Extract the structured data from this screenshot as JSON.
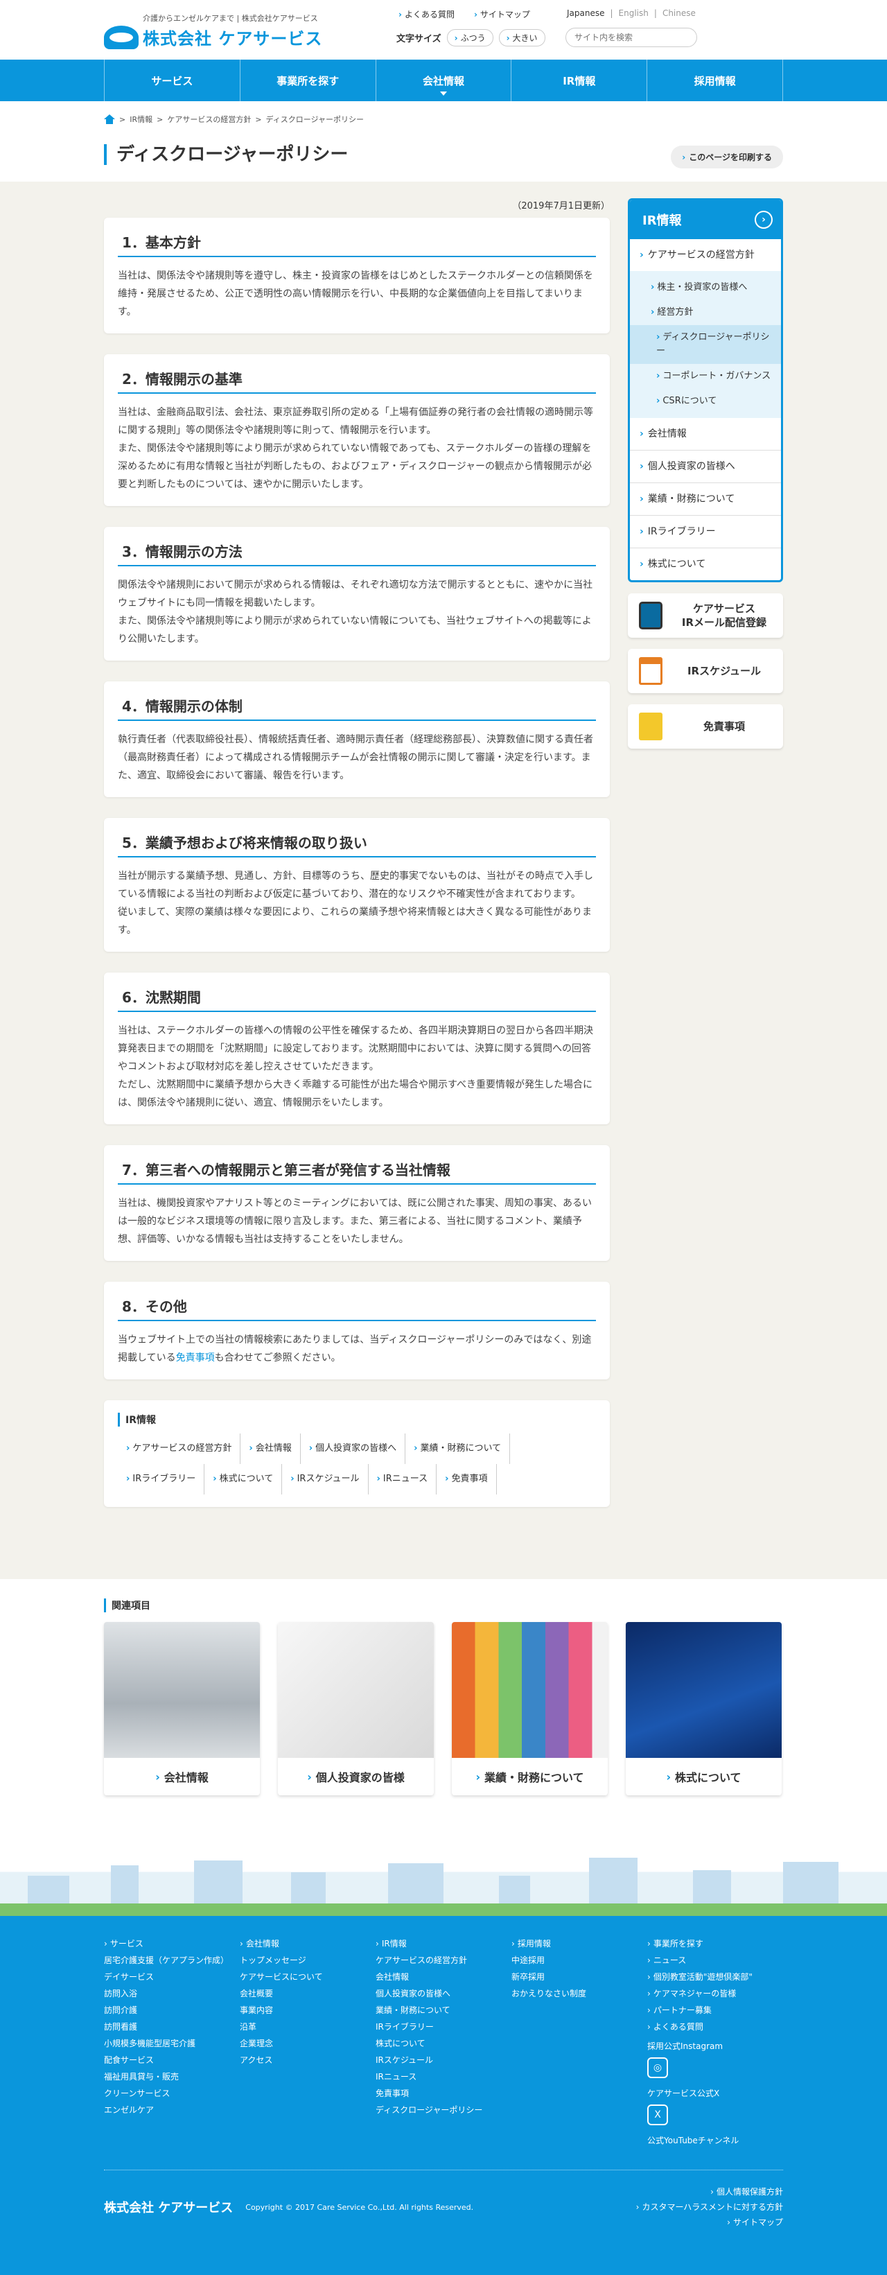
{
  "header": {
    "tagline": "介護からエンゼルケアまで | 株式会社ケアサービス",
    "logo_text": "株式会社 ケアサービス",
    "links": [
      "よくある質問",
      "サイトマップ"
    ],
    "fontsize_label": "文字サイズ",
    "fontsize_normal": "ふつう",
    "fontsize_large": "大きい",
    "langs": [
      "Japanese",
      "English",
      "Chinese"
    ],
    "search_placeholder": "サイト内を検索"
  },
  "nav": [
    "サービス",
    "事業所を探す",
    "会社情報",
    "IR情報",
    "採用情報"
  ],
  "breadcrumb": [
    "IR情報",
    "ケアサービスの経営方針",
    "ディスクロージャーポリシー"
  ],
  "page_title": "ディスクロージャーポリシー",
  "print_label": "このページを印刷する",
  "updated": "（2019年7月1日更新）",
  "sections": [
    {
      "title": "1．基本方針",
      "body": "当社は、関係法令や諸規則等を遵守し、株主・投資家の皆様をはじめとしたステークホルダーとの信頼関係を維持・発展させるため、公正で透明性の高い情報開示を行い、中長期的な企業価値向上を目指してまいります。"
    },
    {
      "title": "2．情報開示の基準",
      "body": "当社は、金融商品取引法、会社法、東京証券取引所の定める「上場有価証券の発行者の会社情報の適時開示等に関する規則」等の関係法令や諸規則等に則って、情報開示を行います。\nまた、関係法令や諸規則等により開示が求められていない情報であっても、ステークホルダーの皆様の理解を深めるために有用な情報と当社が判断したもの、およびフェア・ディスクロージャーの観点から情報開示が必要と判断したものについては、速やかに開示いたします。"
    },
    {
      "title": "3．情報開示の方法",
      "body": "関係法令や諸規則において開示が求められる情報は、それぞれ適切な方法で開示するとともに、速やかに当社ウェブサイトにも同一情報を掲載いたします。\nまた、関係法令や諸規則等により開示が求められていない情報についても、当社ウェブサイトへの掲載等により公開いたします。"
    },
    {
      "title": "4．情報開示の体制",
      "body": "執行責任者（代表取締役社長）、情報統括責任者、適時開示責任者（経理総務部長）、決算数値に関する責任者（最高財務責任者）によって構成される情報開示チームが会社情報の開示に関して審議・決定を行います。また、適宜、取締役会において審議、報告を行います。"
    },
    {
      "title": "5．業績予想および将来情報の取り扱い",
      "body": "当社が開示する業績予想、見通し、方針、目標等のうち、歴史的事実でないものは、当社がその時点で入手している情報による当社の判断および仮定に基づいており、潜在的なリスクや不確実性が含まれております。\n従いまして、実際の業績は様々な要因により、これらの業績予想や将来情報とは大きく異なる可能性があります。"
    },
    {
      "title": "6．沈黙期間",
      "body": "当社は、ステークホルダーの皆様への情報の公平性を確保するため、各四半期決算期日の翌日から各四半期決算発表日までの期間を「沈黙期間」に設定しております。沈黙期間中においては、決算に関する質問への回答やコメントおよび取材対応を差し控えさせていただきます。\nただし、沈黙期間中に業績予想から大きく乖離する可能性が出た場合や開示すべき重要情報が発生した場合には、関係法令や諸規則に従い、適宜、情報開示をいたします。"
    },
    {
      "title": "7．第三者への情報開示と第三者が発信する当社情報",
      "body": "当社は、機関投資家やアナリスト等とのミーティングにおいては、既に公開された事実、周知の事実、あるいは一般的なビジネス環境等の情報に限り言及します。また、第三者による、当社に関するコメント、業績予想、評価等、いかなる情報も当社は支持することをいたしません。"
    }
  ],
  "section8": {
    "title": "8．その他",
    "before": "当ウェブサイト上での当社の情報検索にあたりましては、当ディスクロージャーポリシーのみではなく、別途掲載している",
    "link": "免責事項",
    "after": "も合わせてご参照ください。"
  },
  "ir_links": {
    "title": "IR情報",
    "items": [
      "ケアサービスの経営方針",
      "会社情報",
      "個人投資家の皆様へ",
      "業績・財務について",
      "IRライブラリー",
      "株式について",
      "IRスケジュール",
      "IRニュース",
      "免責事項"
    ]
  },
  "side": {
    "title": "IR情報",
    "top": "ケアサービスの経営方針",
    "sub": [
      "株主・投資家の皆様へ",
      "経営方針",
      "ディスクロージャーポリシー",
      "コーポレート・ガバナンス",
      "CSRについて"
    ],
    "items": [
      "会社情報",
      "個人投資家の皆様へ",
      "業績・財務について",
      "IRライブラリー",
      "株式について"
    ],
    "banners": [
      "ケアサービス\nIRメール配信登録",
      "IRスケジュール",
      "免責事項"
    ]
  },
  "related": {
    "title": "関連項目",
    "cards": [
      "会社情報",
      "個人投資家の皆様",
      "業績・財務について",
      "株式について"
    ]
  },
  "footer": {
    "col1": [
      "サービス",
      "居宅介護支援（ケアプラン作成）",
      "デイサービス",
      "訪問入浴",
      "訪問介護",
      "訪問看護",
      "小規模多機能型居宅介護",
      "配食サービス",
      "福祉用具貸与・販売",
      "クリーンサービス",
      "エンゼルケア"
    ],
    "col2": [
      "会社情報",
      "トップメッセージ",
      "ケアサービスについて",
      "会社概要",
      "事業内容",
      "沿革",
      "企業理念",
      "アクセス"
    ],
    "col3": [
      "IR情報",
      "ケアサービスの経営方針",
      "会社情報",
      "個人投資家の皆様へ",
      "業績・財務について",
      "IRライブラリー",
      "株式について",
      "IRスケジュール",
      "IRニュース",
      "免責事項",
      "ディスクロージャーポリシー"
    ],
    "col4": [
      "採用情報",
      "中途採用",
      "新卒採用",
      "おかえりなさい制度"
    ],
    "col5": [
      "事業所を探す",
      "ニュース",
      "個別教室活動\"遊想倶楽部\"",
      "ケアマネジャーの皆様",
      "パートナー募集",
      "よくある質問"
    ],
    "instagram": "採用公式Instagram",
    "x": "ケアサービス公式X",
    "youtube": "公式YouTubeチャンネル",
    "logo": "株式会社 ケアサービス",
    "copyright": "Copyright © 2017 Care Service Co.,Ltd. All rights Reserved.",
    "bottom_links": [
      "個人情報保護方針",
      "カスタマーハラスメントに対する方針",
      "サイトマップ"
    ]
  }
}
